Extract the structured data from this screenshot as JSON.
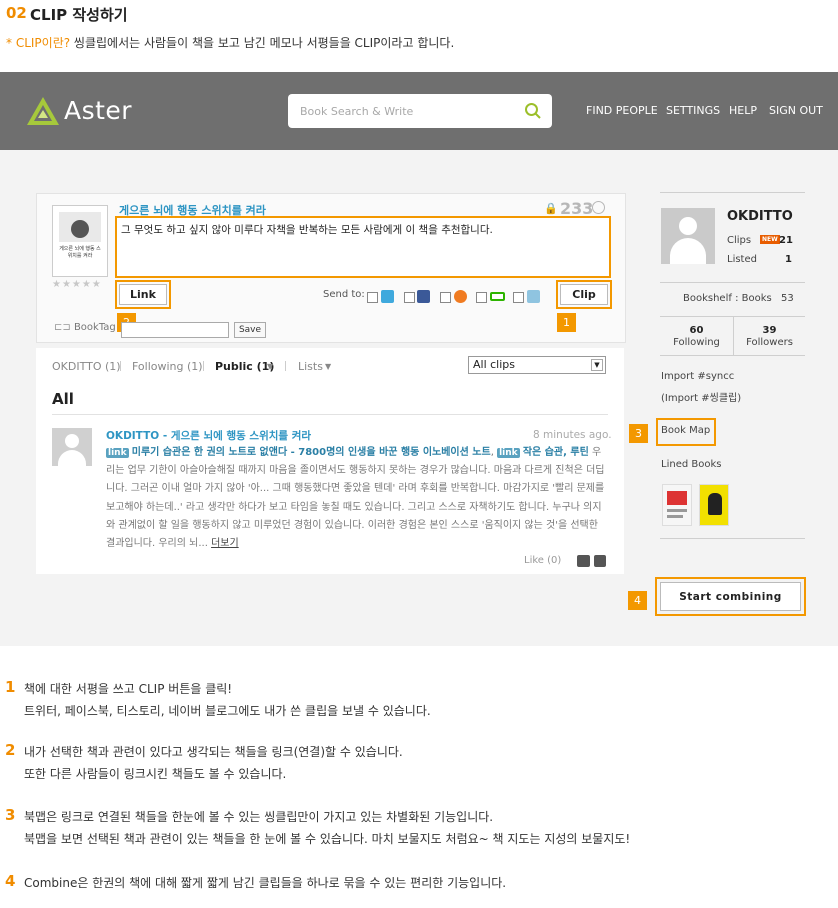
{
  "heading": {
    "num": "02",
    "title": "CLIP 작성하기",
    "sub_highlight": "* CLIP이란?",
    "sub_text": " 씽클립에서는 사람들이 책을 보고 남긴 메모나 서평들을 CLIP이라고 합니다."
  },
  "app": {
    "logo": "Aster",
    "search_placeholder": "Book Search & Write",
    "nav": [
      "FIND PEOPLE",
      "SETTINGS",
      "HELP",
      "SIGN OUT"
    ]
  },
  "clip_form": {
    "book_title": "게으른 뇌에 행동 스위치를 켜라",
    "count": "233",
    "text": "그 무엇도 하고 싶지 않아 미루다 자책을 반복하는 모든 사람에게 이 책을 추천합니다.",
    "link_label": "Link",
    "clip_label": "Clip",
    "send_to": "Send to:",
    "booktag_label": "BookTag",
    "save_label": "Save",
    "cover_text": "게으른 뇌에 행동 스위치를 켜라",
    "stars": "★★★★★"
  },
  "badges": [
    "1",
    "2",
    "3",
    "4"
  ],
  "feed": {
    "tabs": [
      "OKDITTO (1)",
      "Following (1)",
      "Public (1)",
      "Lists"
    ],
    "filter": "All clips",
    "heading": "All",
    "clip": {
      "header": "OKDITTO - 게으른 뇌에 행동 스위치를 켜라",
      "time": "8 minutes ago.",
      "link_tag": "link",
      "link1": "미루기 습관은 한 권의 노트로 없앤다 - 7800명의 인생을 바꾼 행동 이노베이션 노트",
      "link2": "작은 습관, 루틴",
      "body": " 우리는 업무 기한이 아슬아슬해질 때까지 마음을 졸이면서도 행동하지 못하는 경우가 많습니다. 마음과 다르게 진척은 더딥니다. 그러곤 이내 얼마 가지 않아 '아... 그때 행동했다면 좋았을 텐데' 라며 후회를 반복합니다. 마감가지로 '빨리 문제를 보고해야 하는데..' 라고 생각만 하다가 보고 타임을 놓칠 때도 있습니다. 그리고 스스로 자책하기도 합니다. 누구나 의지와 관계없이 할 일을 행동하지 않고 미루었던 경험이 있습니다. 이러한 경험은 본인 스스로 '움직이지 않는 것'을 선택한 결과입니다. 우리의 뇌...",
      "more": "더보기",
      "like": "Like (0)"
    }
  },
  "sidebar": {
    "username": "OKDITTO",
    "clips_label": "Clips",
    "new_badge": "NEW",
    "clips_count": "21",
    "listed_label": "Listed",
    "listed_count": "1",
    "bookshelf": "Bookshelf : Books",
    "bookshelf_count": "53",
    "following_count": "60",
    "following_label": "Following",
    "followers_count": "39",
    "followers_label": "Followers",
    "import1": "Import #syncc",
    "import2": "(Import #씽클립)",
    "book_map": "Book Map",
    "lined_books": "Lined Books",
    "combine": "Start combining"
  },
  "notes": [
    {
      "num": "1",
      "line1": "책에 대한 서평을 쓰고 CLIP 버튼을 클릭!",
      "line2": "트위터, 페이스북, 티스토리, 네이버 블로그에도 내가 쓴 클립을 보낼 수 있습니다."
    },
    {
      "num": "2",
      "line1": "내가 선택한 책과 관련이 있다고 생각되는 책들을 링크(연결)할 수 있습니다.",
      "line2": "또한 다른 사람들이 링크시킨 책들도 볼 수 있습니다."
    },
    {
      "num": "3",
      "line1": "북맵은 링크로 연결된 책들을 한눈에 볼 수 있는 씽클립만이 가지고 있는 차별화된 기능입니다.",
      "line2": "북맵을 보면 선택된 책과 관련이 있는 책들을 한 눈에 볼 수 있습니다. 마치 보물지도 처럼요~ 책 지도는 지성의 보물지도!"
    },
    {
      "num": "4",
      "line1": "Combine은 한권의 책에 대해 짧게 짧게 남긴 클립들을 하나로 묶을 수 있는 편리한 기능입니다.",
      "line2": ""
    }
  ],
  "colors": {
    "accent": "#f39800",
    "link": "#2e95c3",
    "topbar": "#6f6f6f"
  }
}
